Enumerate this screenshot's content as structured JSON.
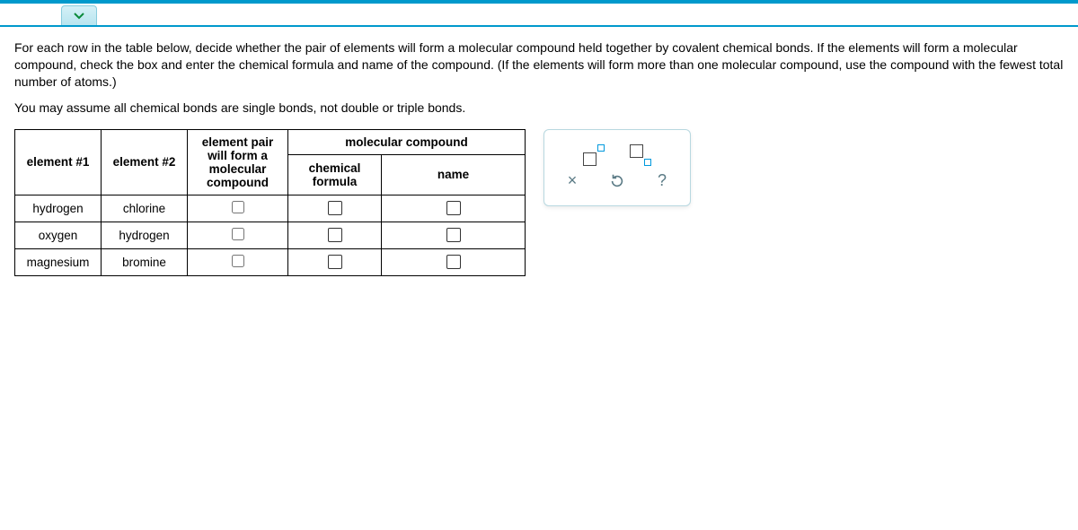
{
  "instructions": {
    "p1": "For each row in the table below, decide whether the pair of elements will form a molecular compound held together by covalent chemical bonds. If the elements will form a molecular compound, check the box and enter the chemical formula and name of the compound. (If the elements will form more than one molecular compound, use the compound with the fewest total number of atoms.)",
    "p2": "You may assume all chemical bonds are single bonds, not double or triple bonds."
  },
  "table": {
    "headers": {
      "el1": "element #1",
      "el2": "element #2",
      "willForm": "element pair will form a molecular compound",
      "molecular": "molecular compound",
      "formula": "chemical formula",
      "name": "name"
    },
    "rows": [
      {
        "el1": "hydrogen",
        "el2": "chlorine"
      },
      {
        "el1": "oxygen",
        "el2": "hydrogen"
      },
      {
        "el1": "magnesium",
        "el2": "bromine"
      }
    ]
  },
  "tools": {
    "close": "×",
    "help": "?"
  }
}
